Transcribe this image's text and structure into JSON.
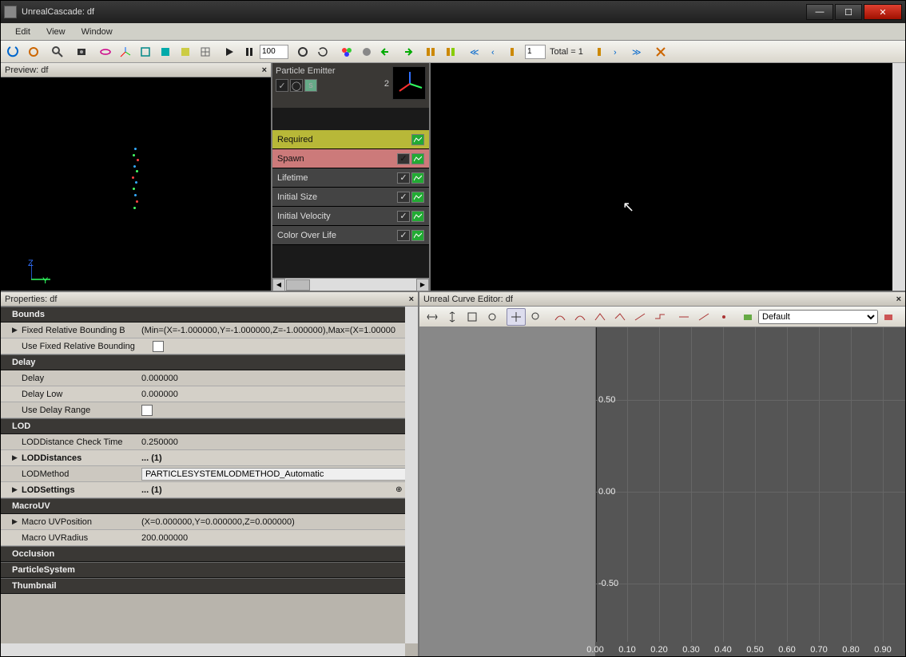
{
  "window": {
    "title": "UnrealCascade: df"
  },
  "menu": {
    "items": [
      "Edit",
      "View",
      "Window"
    ]
  },
  "toolbar": {
    "speed_value": "100",
    "lod_index": "1",
    "lod_total_label": "Total = 1"
  },
  "preview": {
    "title": "Preview: df",
    "axes": {
      "z": "Z",
      "y": "Y"
    }
  },
  "emitter": {
    "title": "Particle Emitter",
    "count": "2",
    "modules": [
      {
        "label": "Required",
        "class": "required",
        "checkbox": false,
        "graph": true
      },
      {
        "label": "Spawn",
        "class": "spawn",
        "checkbox": true,
        "graph": true
      },
      {
        "label": "Lifetime",
        "class": "",
        "checkbox": true,
        "graph": true
      },
      {
        "label": "Initial Size",
        "class": "",
        "checkbox": true,
        "graph": true
      },
      {
        "label": "Initial Velocity",
        "class": "",
        "checkbox": true,
        "graph": true
      },
      {
        "label": "Color Over Life",
        "class": "",
        "checkbox": true,
        "graph": true
      }
    ]
  },
  "properties": {
    "title": "Properties: df",
    "sections": {
      "bounds": {
        "title": "Bounds",
        "fixed_rel": {
          "key": "Fixed Relative Bounding B",
          "val": "(Min=(X=-1.000000,Y=-1.000000,Z=-1.000000),Max=(X=1.00000"
        },
        "use_fixed": {
          "key": "Use Fixed Relative Bounding"
        }
      },
      "delay": {
        "title": "Delay",
        "delay": {
          "key": "Delay",
          "val": "0.000000"
        },
        "delay_low": {
          "key": "Delay Low",
          "val": "0.000000"
        },
        "use_range": {
          "key": "Use Delay Range"
        }
      },
      "lod": {
        "title": "LOD",
        "check_time": {
          "key": "LODDistance Check Time",
          "val": "0.250000"
        },
        "distances": {
          "key": "LODDistances",
          "val": "... (1)"
        },
        "method": {
          "key": "LODMethod",
          "val": "PARTICLESYSTEMLODMETHOD_Automatic"
        },
        "settings": {
          "key": "LODSettings",
          "val": "... (1)"
        }
      },
      "macrouv": {
        "title": "MacroUV",
        "pos": {
          "key": "Macro UVPosition",
          "val": "(X=0.000000,Y=0.000000,Z=0.000000)"
        },
        "radius": {
          "key": "Macro UVRadius",
          "val": "200.000000"
        }
      },
      "occlusion": {
        "title": "Occlusion"
      },
      "particlesystem": {
        "title": "ParticleSystem"
      },
      "thumbnail": {
        "title": "Thumbnail"
      }
    }
  },
  "curve": {
    "title": "Unreal Curve Editor: df",
    "preset": "Default",
    "y_ticks": [
      "0.50",
      "0.00",
      "-0.50"
    ],
    "x_ticks": [
      "0.00",
      "0.10",
      "0.20",
      "0.30",
      "0.40",
      "0.50",
      "0.60",
      "0.70",
      "0.80",
      "0.90"
    ]
  }
}
